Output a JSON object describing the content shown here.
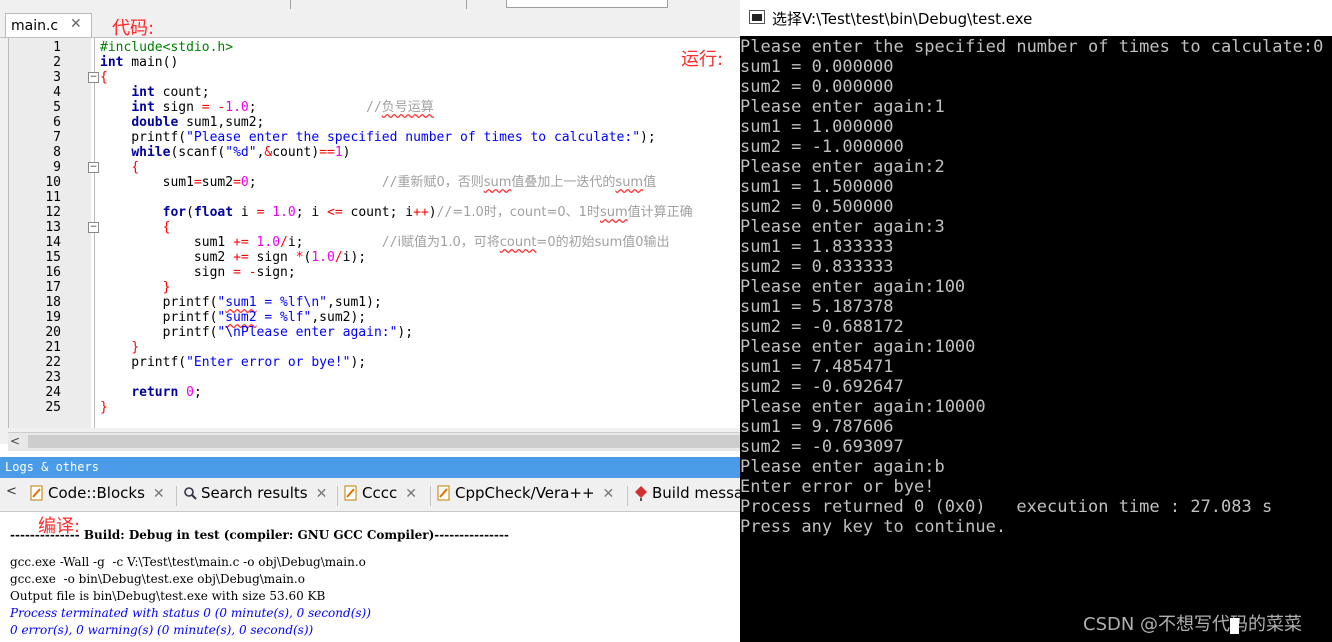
{
  "editor": {
    "tab_label": "main.c",
    "tab_close": "✕",
    "annotation_code": "代码:",
    "annotation_run": "运行:",
    "line_numbers": [
      "1",
      "2",
      "3",
      "4",
      "5",
      "6",
      "7",
      "8",
      "9",
      "10",
      "11",
      "12",
      "13",
      "14",
      "15",
      "16",
      "17",
      "18",
      "19",
      "20",
      "21",
      "22",
      "23",
      "24",
      "25"
    ],
    "lines": [
      "#include<stdio.h>",
      "int main()",
      "{",
      "    int count;",
      "    int sign = -1.0;              //负号运算",
      "    double sum1,sum2;",
      "    printf(\"Please enter the specified number of times to calculate:\");",
      "    while(scanf(\"%d\",&count)==1)",
      "    {",
      "        sum1=sum2=0;                //重新赋0，否则sum值叠加上一迭代的sum值",
      "",
      "        for(float i = 1.0; i <= count; i++)//=1.0时，count=0、1时sum值计算正确",
      "        {",
      "            sum1 += 1.0/i;          //i赋值为1.0，可将count=0的初始sum值0输出",
      "            sum2 += sign *(1.0/i);",
      "            sign = -sign;",
      "        }",
      "        printf(\"sum1 = %lf\\n\",sum1);",
      "        printf(\"sum2 = %lf\",sum2);",
      "        printf(\"\\nPlease enter again:\");",
      "    }",
      "    printf(\"Enter error or bye!\");",
      "",
      "    return 0;",
      "}"
    ],
    "hscroll_arrow": "<"
  },
  "logs": {
    "title": "Logs & others",
    "nav_arrow": "<",
    "tabs": [
      {
        "label": "Code::Blocks",
        "close": "✕"
      },
      {
        "label": "Search results",
        "close": "✕"
      },
      {
        "label": "Cccc",
        "close": "✕"
      },
      {
        "label": "CppCheck/Vera++",
        "close": "✕"
      },
      {
        "label": "Build messa",
        "close": ""
      }
    ],
    "annotation_compile": "编译:",
    "lines": [
      "-------------- Build: Debug in test (compiler: GNU GCC Compiler)---------------",
      "gcc.exe -Wall -g  -c V:\\Test\\test\\main.c -o obj\\Debug\\main.o",
      "gcc.exe  -o bin\\Debug\\test.exe obj\\Debug\\main.o",
      "Output file is bin\\Debug\\test.exe with size 53.60 KB",
      "Process terminated with status 0 (0 minute(s), 0 second(s))",
      "0 error(s), 0 warning(s) (0 minute(s), 0 second(s))"
    ]
  },
  "console": {
    "title": "选择V:\\Test\\test\\bin\\Debug\\test.exe",
    "lines": [
      "Please enter the specified number of times to calculate:0",
      "sum1 = 0.000000",
      "sum2 = 0.000000",
      "Please enter again:1",
      "sum1 = 1.000000",
      "sum2 = -1.000000",
      "Please enter again:2",
      "sum1 = 1.500000",
      "sum2 = 0.500000",
      "Please enter again:3",
      "sum1 = 1.833333",
      "sum2 = 0.833333",
      "Please enter again:100",
      "sum1 = 5.187378",
      "sum2 = -0.688172",
      "Please enter again:1000",
      "sum1 = 7.485471",
      "sum2 = -0.692647",
      "Please enter again:10000",
      "sum1 = 9.787606",
      "sum2 = -0.693097",
      "Please enter again:b",
      "Enter error or bye!",
      "Process returned 0 (0x0)   execution time : 27.083 s",
      "Press any key to continue."
    ],
    "watermark": "CSDN @不想写代码的菜菜"
  },
  "colors": {
    "keyword": "#0000a0",
    "number": "#f000f0",
    "string": "#0000ff",
    "comment": "#a0a0a0",
    "preprocessor": "#008000",
    "annotation": "#ff2a2a",
    "logs_title_bg": "#4a9ce8",
    "console_bg": "#000000",
    "console_text": "#c0c0c0"
  }
}
